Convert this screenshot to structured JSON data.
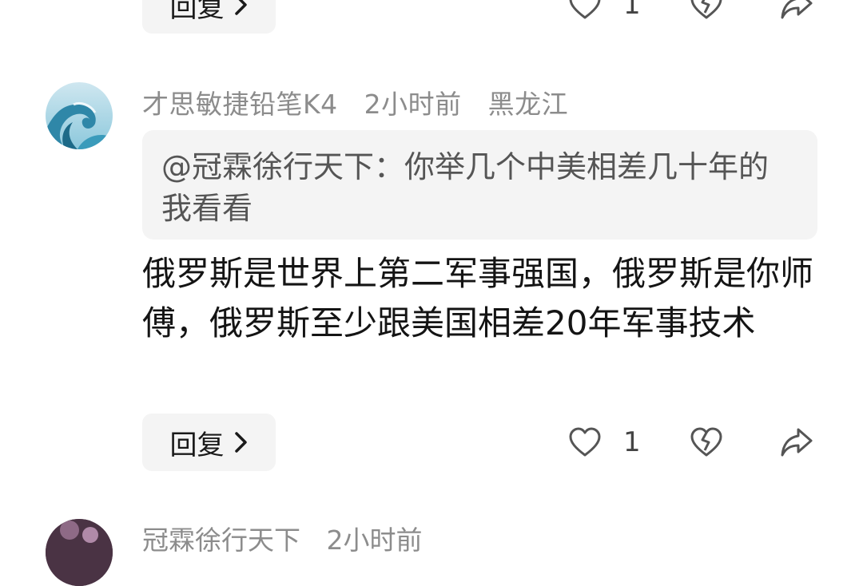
{
  "previous_comment": {
    "reply_label": "回复",
    "like_count": "1"
  },
  "comment": {
    "username": "才思敏捷铅笔K4",
    "time": "2小时前",
    "location": "黑龙江",
    "quote": "@冠霖徐行天下：你举几个中美相差几十年的我看看",
    "text": "俄罗斯是世界上第二军事强国，俄罗斯是你师傅，俄罗斯至少跟美国相差20年军事技术",
    "reply_label": "回复",
    "like_count": "1"
  },
  "next_comment": {
    "username": "冠霖徐行天下",
    "time": "2小时前"
  },
  "icons": {
    "like": "heart-outline-icon",
    "dislike": "broken-heart-icon",
    "share": "share-arrow-icon",
    "reply_arrow": "chevron-right-icon"
  }
}
